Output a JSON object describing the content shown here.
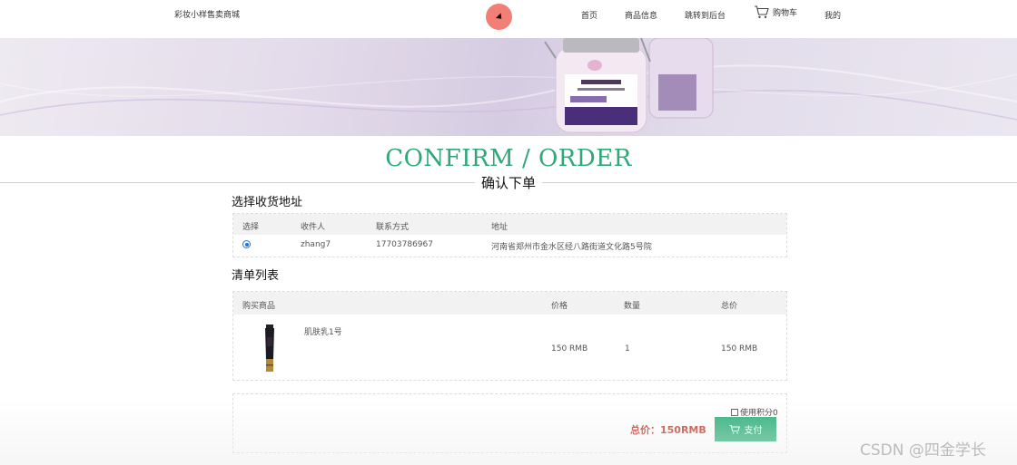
{
  "nav": {
    "brand": "彩妆小样售卖商城",
    "home": "首页",
    "products": "商品信息",
    "admin": "跳转到后台",
    "cart": "购物车",
    "mine": "我的"
  },
  "title": {
    "en": "CONFIRM / ORDER",
    "cn": "确认下单"
  },
  "address_section": {
    "label": "选择收货地址",
    "headers": {
      "select": "选择",
      "recipient": "收件人",
      "phone": "联系方式",
      "address": "地址"
    },
    "rows": [
      {
        "recipient": "zhang7",
        "phone": "17703786967",
        "address": "河南省郑州市金水区经八路街道文化路5号院"
      }
    ]
  },
  "list_section": {
    "label": "清单列表",
    "headers": {
      "product": "购买商品",
      "price": "价格",
      "qty": "数量",
      "subtotal": "总价"
    },
    "rows": [
      {
        "name": "肌肤乳1号",
        "price": "150 RMB",
        "qty": "1",
        "subtotal": "150 RMB"
      }
    ]
  },
  "summary": {
    "points_label": "使用积分0",
    "total": "总价：150RMB",
    "pay_label": "支付"
  },
  "watermark": "CSDN @四金学长",
  "colors": {
    "accent_green": "#2fa776",
    "pay_button": "#2baf77",
    "total_red": "#c0392b"
  }
}
